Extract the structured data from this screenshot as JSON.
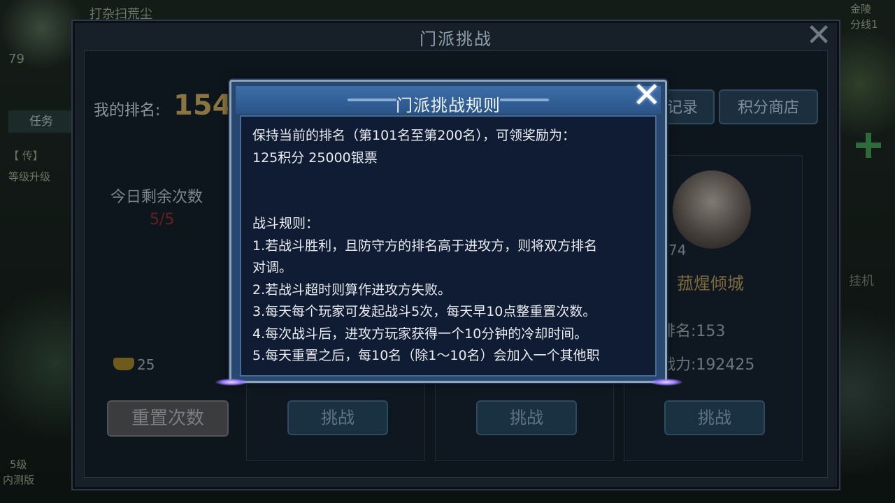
{
  "background": {
    "world_title": "打杂扫荒尘",
    "player_level": "79",
    "task_tab": "任务",
    "quest_line1": "【 传】",
    "quest_line2": "等级升级",
    "server_tag": "金陵",
    "server_line": "分线1",
    "idle_label": "挂机",
    "bottom_left1": "5级",
    "bottom_left2": "内测版"
  },
  "main": {
    "title": "门派挑战",
    "my_rank_label": "我的排名:",
    "my_rank_value": "154",
    "records_button": "记录",
    "shop_button": "积分商店",
    "remain_label": "今日剩余次数",
    "remain_value": "5/5",
    "gold_value": "25",
    "reset_button": "重置次数",
    "challenge_buttons": [
      "挑战",
      "挑战",
      "挑战"
    ],
    "opponent": {
      "level": "74",
      "name": "菰煋倾城",
      "rank_label": "排名:",
      "rank_value": "153",
      "power_label": "战力:",
      "power_value": "192425"
    }
  },
  "dialog": {
    "title": "门派挑战规则",
    "lines": [
      "保持当前的排名（第101名至第200名），可领奖励为：",
      "125积分 25000银票",
      "",
      "",
      "战斗规则：",
      "1.若战斗胜利，且防守方的排名高于进攻方，则将双方排名",
      "对调。",
      "2.若战斗超时则算作进攻方失败。",
      "3.每天每个玩家可发起战斗5次，每天早10点整重置次数。",
      "4.每次战斗后，进攻方玩家获得一个10分钟的冷却时间。",
      "5.每天重置之后，每10名（除1～10名）会加入一个其他职"
    ]
  },
  "colors": {
    "dialog_bg": "#101b34",
    "dialog_border": "#8fa5bb",
    "title_bar": "#3d6ea8",
    "rank_gold": "#8a7540",
    "remain_red": "#6a1f1f"
  }
}
